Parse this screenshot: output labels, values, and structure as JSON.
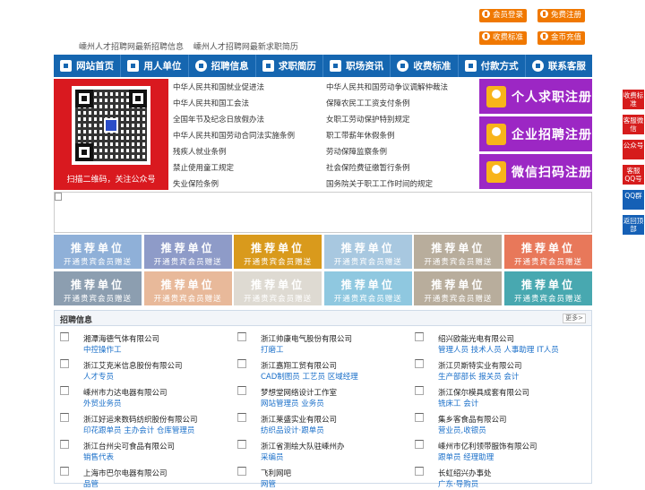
{
  "top_links": [
    "嵊州人才招聘网最新招聘信息",
    "嵊州人才招聘网最新求职简历"
  ],
  "buttons": {
    "member_login": "会员登录",
    "free_register": "免费注册",
    "fee_standard": "收费标准",
    "coin_recharge": "金币充值"
  },
  "nav": [
    "网站首页",
    "用人单位",
    "招聘信息",
    "求职简历",
    "职场资讯",
    "收费标准",
    "付款方式",
    "联系客服"
  ],
  "qr_caption": "扫描二维码，关注公众号",
  "laws_left": [
    "中华人民共和国就业促进法",
    "中华人民共和国工会法",
    "全国年节及纪念日放假办法",
    "中华人民共和国劳动合同法实施条例",
    "残疾人就业条例",
    "禁止使用童工规定",
    "失业保险条例"
  ],
  "laws_right": [
    "中华人民共和国劳动争议调解仲裁法",
    "保障农民工工资支付条例",
    "女职工劳动保护特别规定",
    "职工带薪年休假条例",
    "劳动保障监察条例",
    "社会保险费征缴暂行条例",
    "国务院关于职工工作时间的规定"
  ],
  "register": {
    "personal": "个人求职注册",
    "company": "企业招聘注册",
    "wechat": "微信扫码注册"
  },
  "tile_text": {
    "title": "推荐单位",
    "subtitle": "开通贵宾会员赠送"
  },
  "tile_colors": [
    "#8fb0d8",
    "#8e9bc8",
    "#d99a1c",
    "#a8c8e0",
    "#b8ad9c",
    "#e8785a",
    "#8c9eb0",
    "#e8b99a",
    "#dedad2",
    "#8fc8e0",
    "#b8ad9c",
    "#48a8b0"
  ],
  "jobs_section": {
    "title": "招聘信息",
    "more": "更多>"
  },
  "jobs": [
    {
      "company": "湘潭海德气体有限公司",
      "positions": "中控操作工"
    },
    {
      "company": "浙江帅康电气股份有限公司",
      "positions": "打磨工"
    },
    {
      "company": "绍兴欧能光电有限公司",
      "positions": "管理人员 技术人员 人事助理 IT人员"
    },
    {
      "company": "浙江艾克米信息股份有限公司",
      "positions": "人才专员"
    },
    {
      "company": "浙江嘉翔工贸有限公司",
      "positions": "CAD制图员 工艺员 区域经理"
    },
    {
      "company": "浙江贝斯特实业有限公司",
      "positions": "生产部部长 报关员 会计"
    },
    {
      "company": "嵊州市力达电器有限公司",
      "positions": "外贸业务员"
    },
    {
      "company": "梦想堂网络设计工作室",
      "positions": "网站管理员 业务员"
    },
    {
      "company": "浙江保尔模具成套有限公司",
      "positions": "铣床工 会计"
    },
    {
      "company": "浙江好运来数码纺织股份有限公司",
      "positions": "印花跟单员 主办会计 仓库管理员"
    },
    {
      "company": "浙江莱盛实业有限公司",
      "positions": "纺织品设计·跟单员"
    },
    {
      "company": "集乡客食品有限公司",
      "positions": "营业员,收银员"
    },
    {
      "company": "浙江台州尖可食品有限公司",
      "positions": "销售代表"
    },
    {
      "company": "浙江省测绘大队驻嵊州办",
      "positions": "采编员"
    },
    {
      "company": "嵊州市亿利领带服饰有限公司",
      "positions": "跟单员 经理助理"
    },
    {
      "company": "上海市巴尔电器有限公司",
      "positions": "品管"
    },
    {
      "company": "飞利网吧",
      "positions": "网管"
    },
    {
      "company": "长虹绍兴办事处",
      "positions": "广东·导购员"
    }
  ],
  "side": [
    "收费标准",
    "客服微信",
    "公众号",
    "客服QQ号",
    "QQ群",
    "返回顶部"
  ]
}
